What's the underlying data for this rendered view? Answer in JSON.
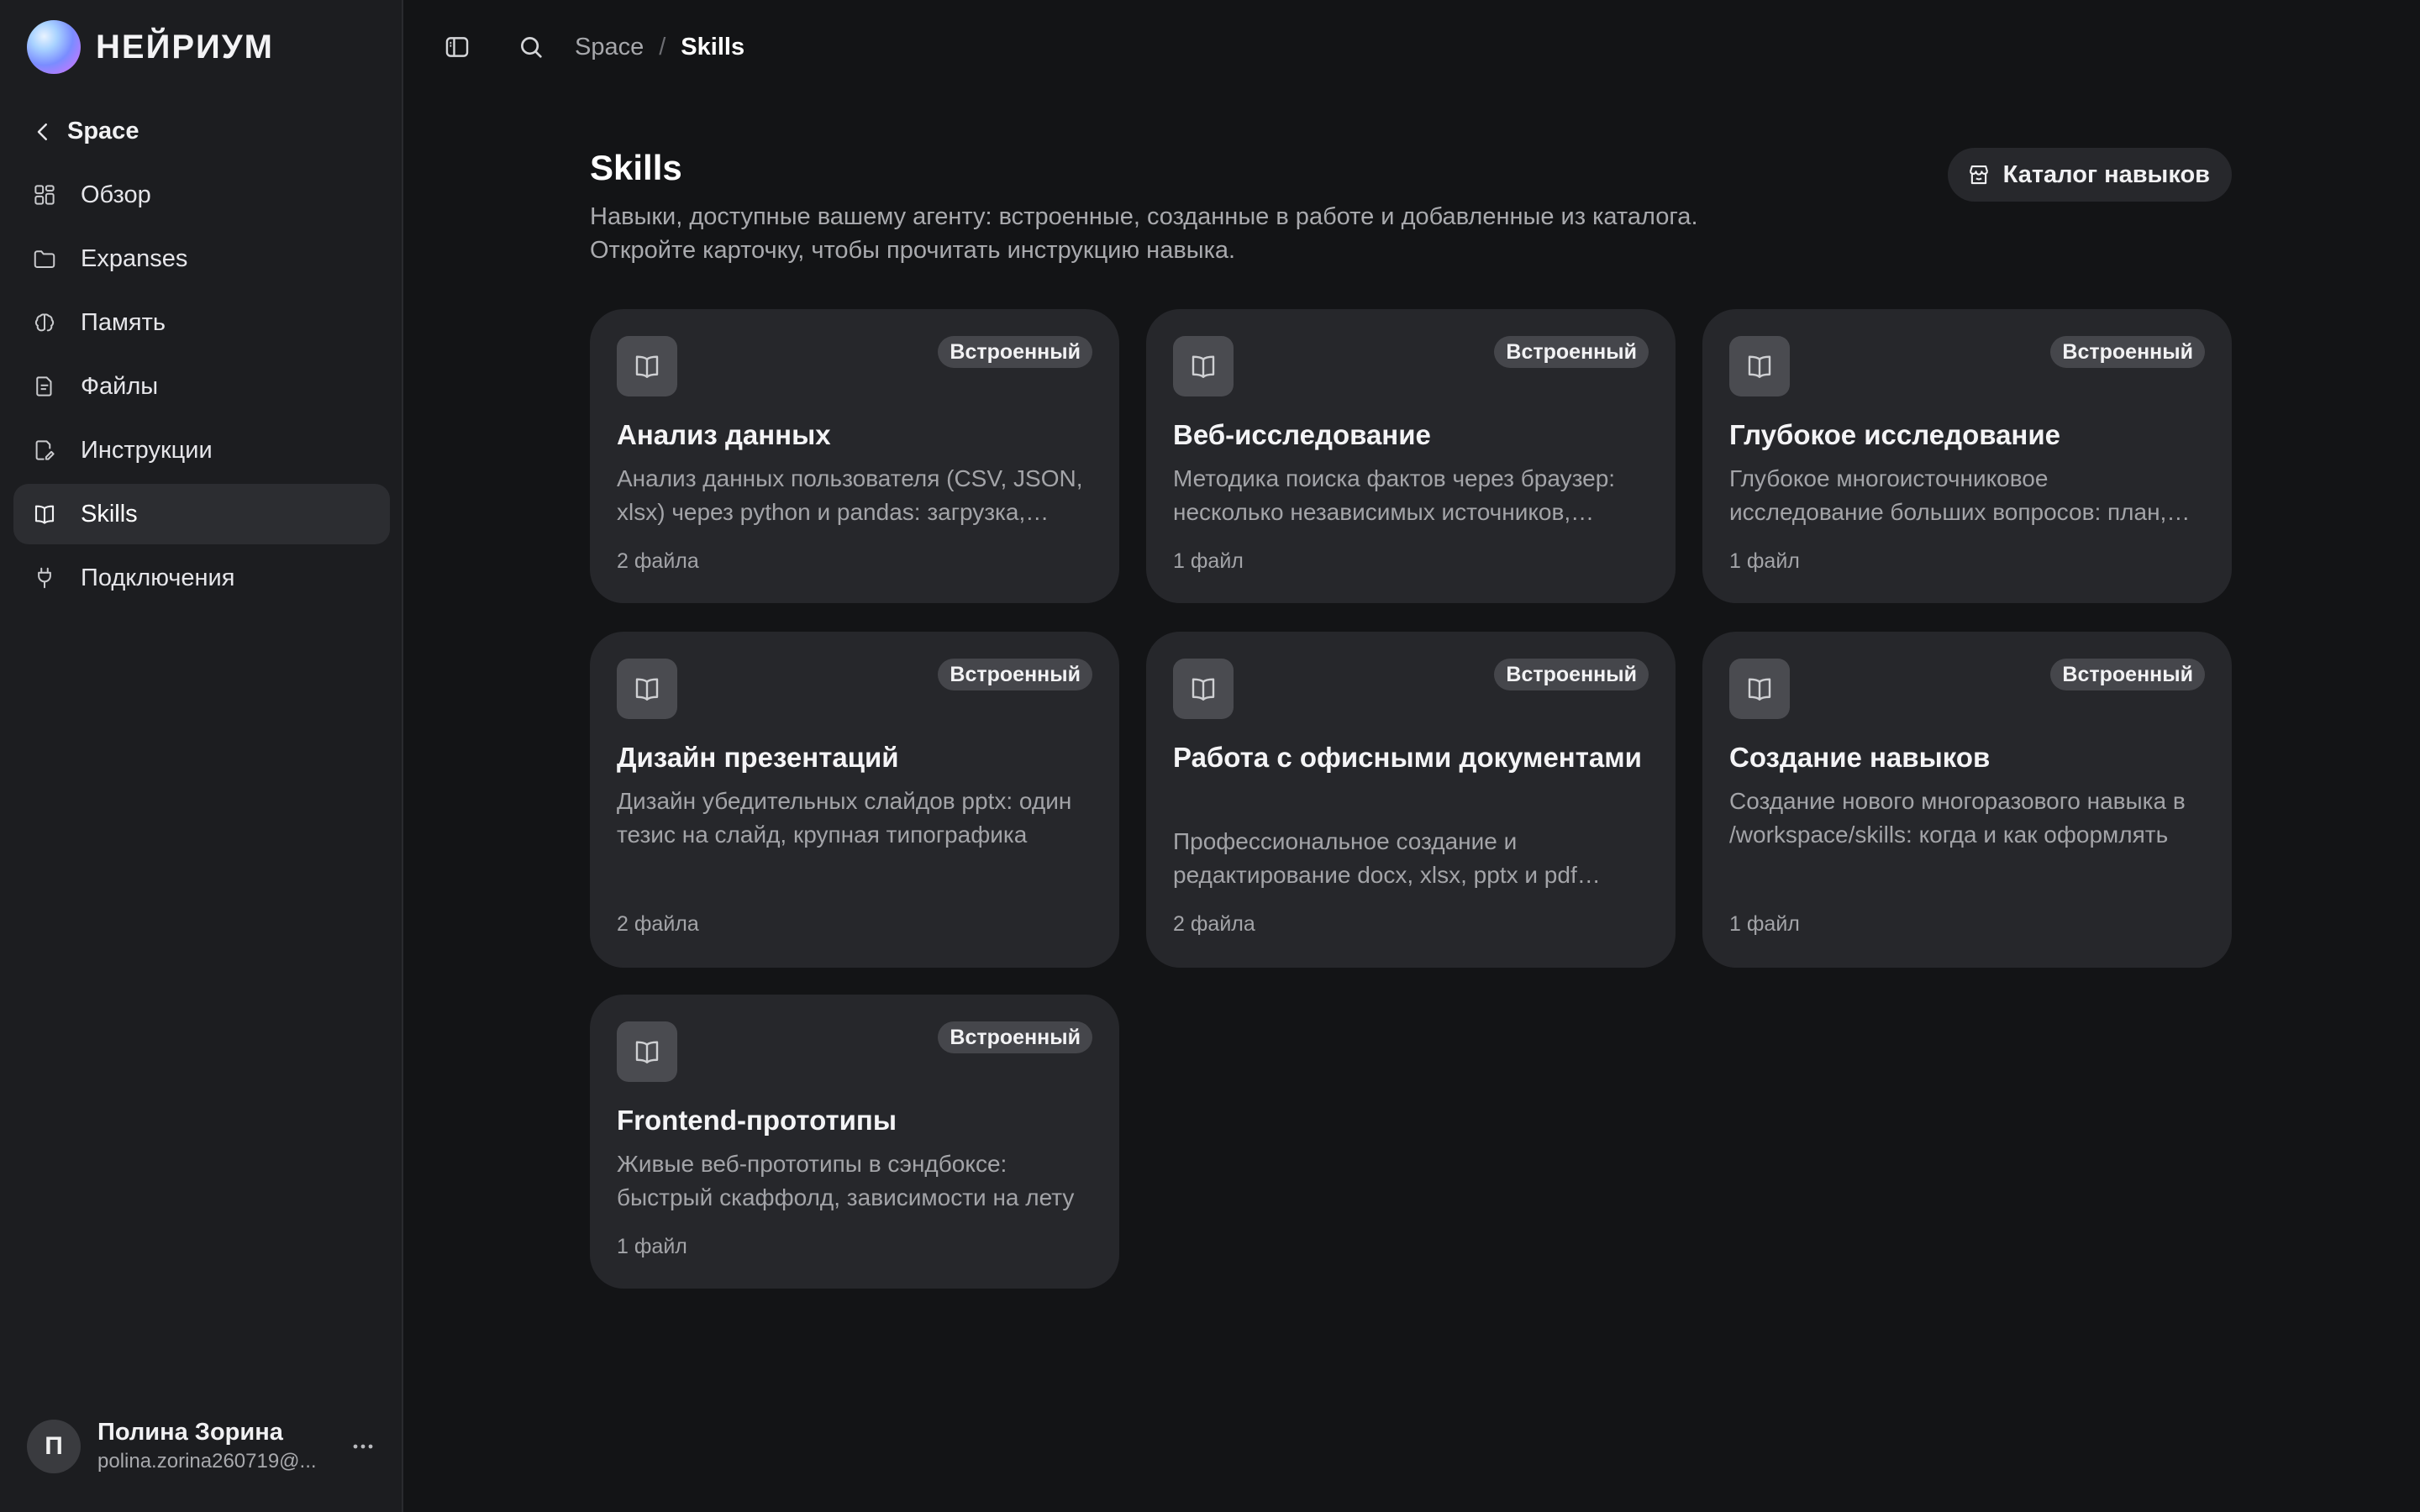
{
  "brand": {
    "name": "НЕЙРИУМ"
  },
  "sidebar": {
    "back_label": "Space",
    "items": [
      {
        "label": "Обзор",
        "icon": "grid-icon",
        "active": false
      },
      {
        "label": "Expanses",
        "icon": "folder-icon",
        "active": false
      },
      {
        "label": "Память",
        "icon": "brain-icon",
        "active": false
      },
      {
        "label": "Файлы",
        "icon": "file-icon",
        "active": false
      },
      {
        "label": "Инструкции",
        "icon": "document-edit-icon",
        "active": false
      },
      {
        "label": "Skills",
        "icon": "book-icon",
        "active": true
      },
      {
        "label": "Подключения",
        "icon": "plug-icon",
        "active": false
      }
    ]
  },
  "user": {
    "initial": "П",
    "name": "Полина Зорина",
    "email": "polina.zorina260719@..."
  },
  "breadcrumb": {
    "parent": "Space",
    "separator": "/",
    "current": "Skills"
  },
  "page": {
    "title": "Skills",
    "description": "Навыки, доступные вашему агенту: встроенные, созданные в работе и добавленные из каталога. Откройте карточку, чтобы прочитать инструкцию навыка.",
    "catalog_button": "Каталог навыков"
  },
  "skills": [
    {
      "badge": "Встроенный",
      "title": "Анализ данных",
      "description": "Анализ данных пользователя (CSV, JSON, xlsx) через python и pandas: загрузка, очистка, визуализация",
      "files": "2 файла"
    },
    {
      "badge": "Встроенный",
      "title": "Веб-исследование",
      "description": "Методика поиска фактов через браузер: несколько независимых источников, проверка цитат",
      "files": "1 файл"
    },
    {
      "badge": "Встроенный",
      "title": "Глубокое исследование",
      "description": "Глубокое многоисточниковое исследование больших вопросов: план, сбор, синтез",
      "files": "1 файл"
    },
    {
      "badge": "Встроенный",
      "title": "Дизайн презентаций",
      "description": "Дизайн убедительных слайдов pptx: один тезис на слайд, крупная типографика",
      "files": "2 файла"
    },
    {
      "badge": "Встроенный",
      "title": "Работа с офисными документами",
      "description": "Профессиональное создание и редактирование docx, xlsx, pptx и pdf файлов",
      "files": "2 файла"
    },
    {
      "badge": "Встроенный",
      "title": "Создание навыков",
      "description": "Создание нового многоразового навыка в /workspace/skills: когда и как оформлять",
      "files": "1 файл"
    },
    {
      "badge": "Встроенный",
      "title": "Frontend-прототипы",
      "description": "Живые веб-прототипы в сэндбоксе: быстрый скаффолд, зависимости на лету",
      "files": "1 файл"
    }
  ]
}
